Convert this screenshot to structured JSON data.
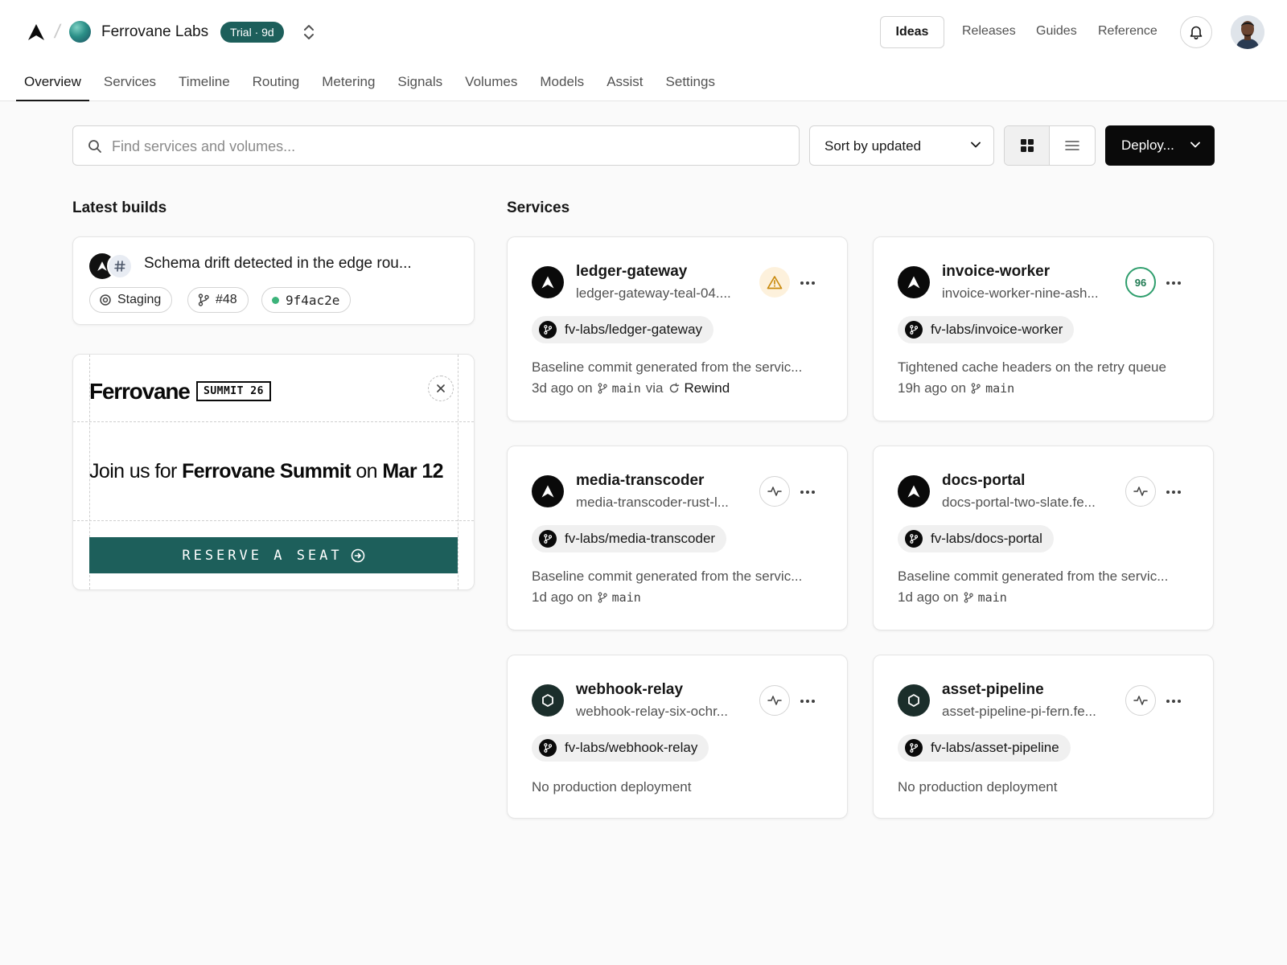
{
  "header": {
    "team": "Ferrovane Labs",
    "trial_badge": "Trial · 9d",
    "nav_links": [
      "Ideas",
      "Releases",
      "Guides",
      "Reference"
    ]
  },
  "tabs": [
    {
      "label": "Overview",
      "active": true
    },
    {
      "label": "Services"
    },
    {
      "label": "Timeline"
    },
    {
      "label": "Routing"
    },
    {
      "label": "Metering"
    },
    {
      "label": "Signals"
    },
    {
      "label": "Volumes"
    },
    {
      "label": "Models"
    },
    {
      "label": "Assist"
    },
    {
      "label": "Settings"
    }
  ],
  "toolbar": {
    "search_placeholder": "Find services and volumes...",
    "sort_label": "Sort by updated",
    "deploy_label": "Deploy..."
  },
  "latest_builds": {
    "title": "Latest builds",
    "build": {
      "title": "Schema drift detected in the edge rou...",
      "environment": "Staging",
      "pr": "#48",
      "commit": "9f4ac2e",
      "commit_status_color": "#3cb37a"
    }
  },
  "promo": {
    "brand": "Ferrovane",
    "tag": "SUMMIT 26",
    "text_pre": "Join us for ",
    "text_event": "Ferrovane Summit",
    "text_mid": " on ",
    "text_date": "Mar 12",
    "cta": "RESERVE A SEAT"
  },
  "services_section": {
    "title": "Services",
    "items": [
      {
        "name": "ledger-gateway",
        "url": "ledger-gateway-teal-04....",
        "icon": "triangle-logo-icon",
        "badge": "warning",
        "repo": "fv-labs/ledger-gateway",
        "commit": "Baseline commit generated from the servic...",
        "time": "3d ago on",
        "branch": "main",
        "via": "via",
        "via_label": "Rewind"
      },
      {
        "name": "invoice-worker",
        "url": "invoice-worker-nine-ash...",
        "icon": "triangle-logo-icon",
        "badge": "score",
        "score": "96",
        "repo": "fv-labs/invoice-worker",
        "commit": "Tightened cache headers on the retry queue",
        "time": "19h ago on",
        "branch": "main"
      },
      {
        "name": "media-transcoder",
        "url": "media-transcoder-rust-l...",
        "icon": "triangle-logo-icon",
        "badge": "pulse",
        "repo": "fv-labs/media-transcoder",
        "commit": "Baseline commit generated from the servic...",
        "time": "1d ago on",
        "branch": "main"
      },
      {
        "name": "docs-portal",
        "url": "docs-portal-two-slate.fe...",
        "icon": "triangle-logo-icon",
        "badge": "pulse",
        "repo": "fv-labs/docs-portal",
        "commit": "Baseline commit generated from the servic...",
        "time": "1d ago on",
        "branch": "main"
      },
      {
        "name": "webhook-relay",
        "url": "webhook-relay-six-ochr...",
        "icon": "hexagon-icon",
        "badge": "pulse",
        "repo": "fv-labs/webhook-relay",
        "status": "No production deployment"
      },
      {
        "name": "asset-pipeline",
        "url": "asset-pipeline-pi-fern.fe...",
        "icon": "hexagon-icon",
        "badge": "pulse",
        "repo": "fv-labs/asset-pipeline",
        "status": "No production deployment"
      }
    ]
  },
  "colors": {
    "accent": "#1d5f5b",
    "primary_button": "#0a0a0a",
    "score_ring": "#2f9e6d",
    "warning_bg": "#fdf1dc",
    "warning_icon": "#c98a0e"
  }
}
